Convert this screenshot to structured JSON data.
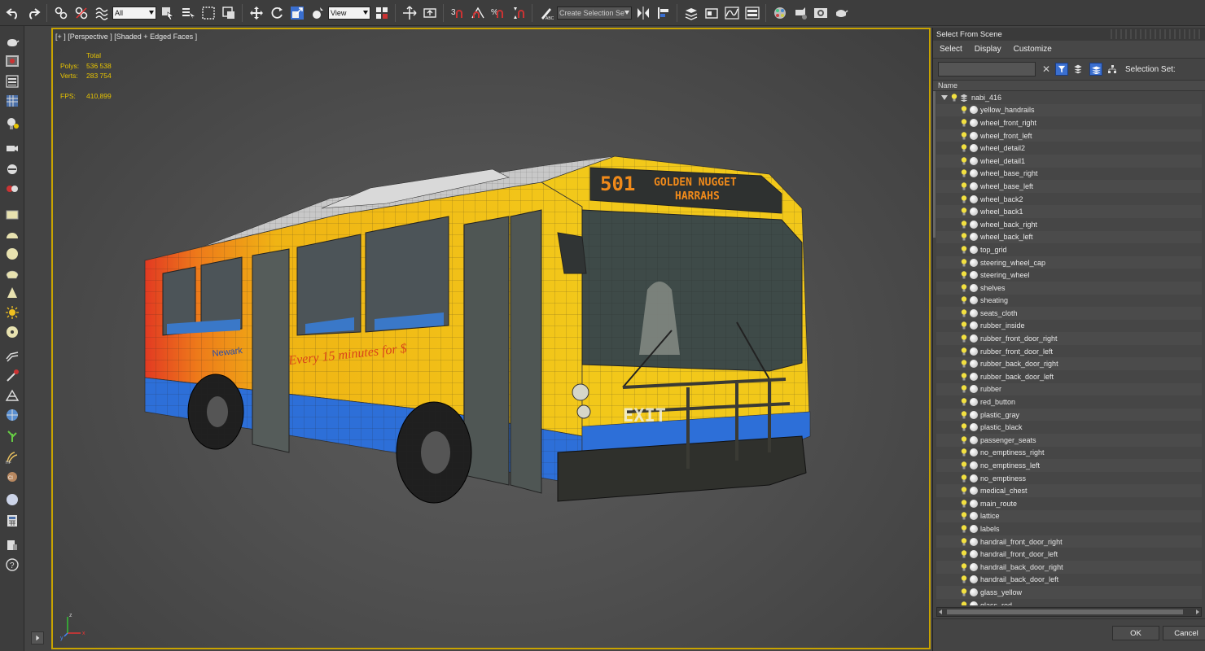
{
  "toolbar": {
    "selection_filter": "All",
    "reference_coord": "View",
    "named_selection": "Create Selection Se",
    "icons": [
      "undo-icon",
      "redo-icon",
      "link-icon",
      "unlink-icon",
      "bind-space-warp-icon",
      "select-object-icon",
      "select-by-name-icon",
      "rect-region-icon",
      "window-crossing-icon",
      "move-icon",
      "rotate-icon",
      "scale-icon",
      "place-icon",
      "pivot-icon",
      "snap-icon",
      "angle-snap-icon",
      "percent-snap-icon",
      "spinner-snap-icon",
      "edit-named-sel-icon",
      "mirror-icon",
      "align-icon",
      "scene-explorer-icon",
      "layer-explorer-icon",
      "curve-editor-icon",
      "schematic-icon",
      "material-editor-icon",
      "render-setup-icon",
      "render-frame-icon",
      "render-icon"
    ]
  },
  "viewport": {
    "label": "[+ ] [Perspective ] [Shaded + Edged Faces ]",
    "stats": {
      "total_label": "Total",
      "polys_label": "Polys:",
      "polys_value": "536 538",
      "verts_label": "Verts:",
      "verts_value": "283 754",
      "fps_label": "FPS:",
      "fps_value": "410,899"
    },
    "bus_sign": {
      "route": "501",
      "line1": "GOLDEN NUGGET",
      "line2": "HARRAHS"
    },
    "axis_labels": {
      "x": "x",
      "y": "y",
      "z": "z"
    }
  },
  "explorer": {
    "title": "Select From Scene",
    "menu": [
      "Select",
      "Display",
      "Customize"
    ],
    "search_value": "",
    "selection_set_label": "Selection Set:",
    "column_name": "Name",
    "root": "nabi_416",
    "objects": [
      "yellow_handrails",
      "wheel_front_right",
      "wheel_front_left",
      "wheel_detail2",
      "wheel_detail1",
      "wheel_base_right",
      "wheel_base_left",
      "wheel_back2",
      "wheel_back1",
      "wheel_back_right",
      "wheel_back_left",
      "top_grid",
      "steering_wheel_cap",
      "steering_wheel",
      "shelves",
      "sheating",
      "seats_cloth",
      "rubber_inside",
      "rubber_front_door_right",
      "rubber_front_door_left",
      "rubber_back_door_right",
      "rubber_back_door_left",
      "rubber",
      "red_button",
      "plastic_gray",
      "plastic_black",
      "passenger_seats",
      "no_emptiness_right",
      "no_emptiness_left",
      "no_emptiness",
      "medical_chest",
      "main_route",
      "lattice",
      "labels",
      "handrail_front_door_right",
      "handrail_front_door_left",
      "handrail_back_door_right",
      "handrail_back_door_left",
      "glass_yellow",
      "glass_red"
    ],
    "ok_label": "OK",
    "cancel_label": "Cancel"
  }
}
